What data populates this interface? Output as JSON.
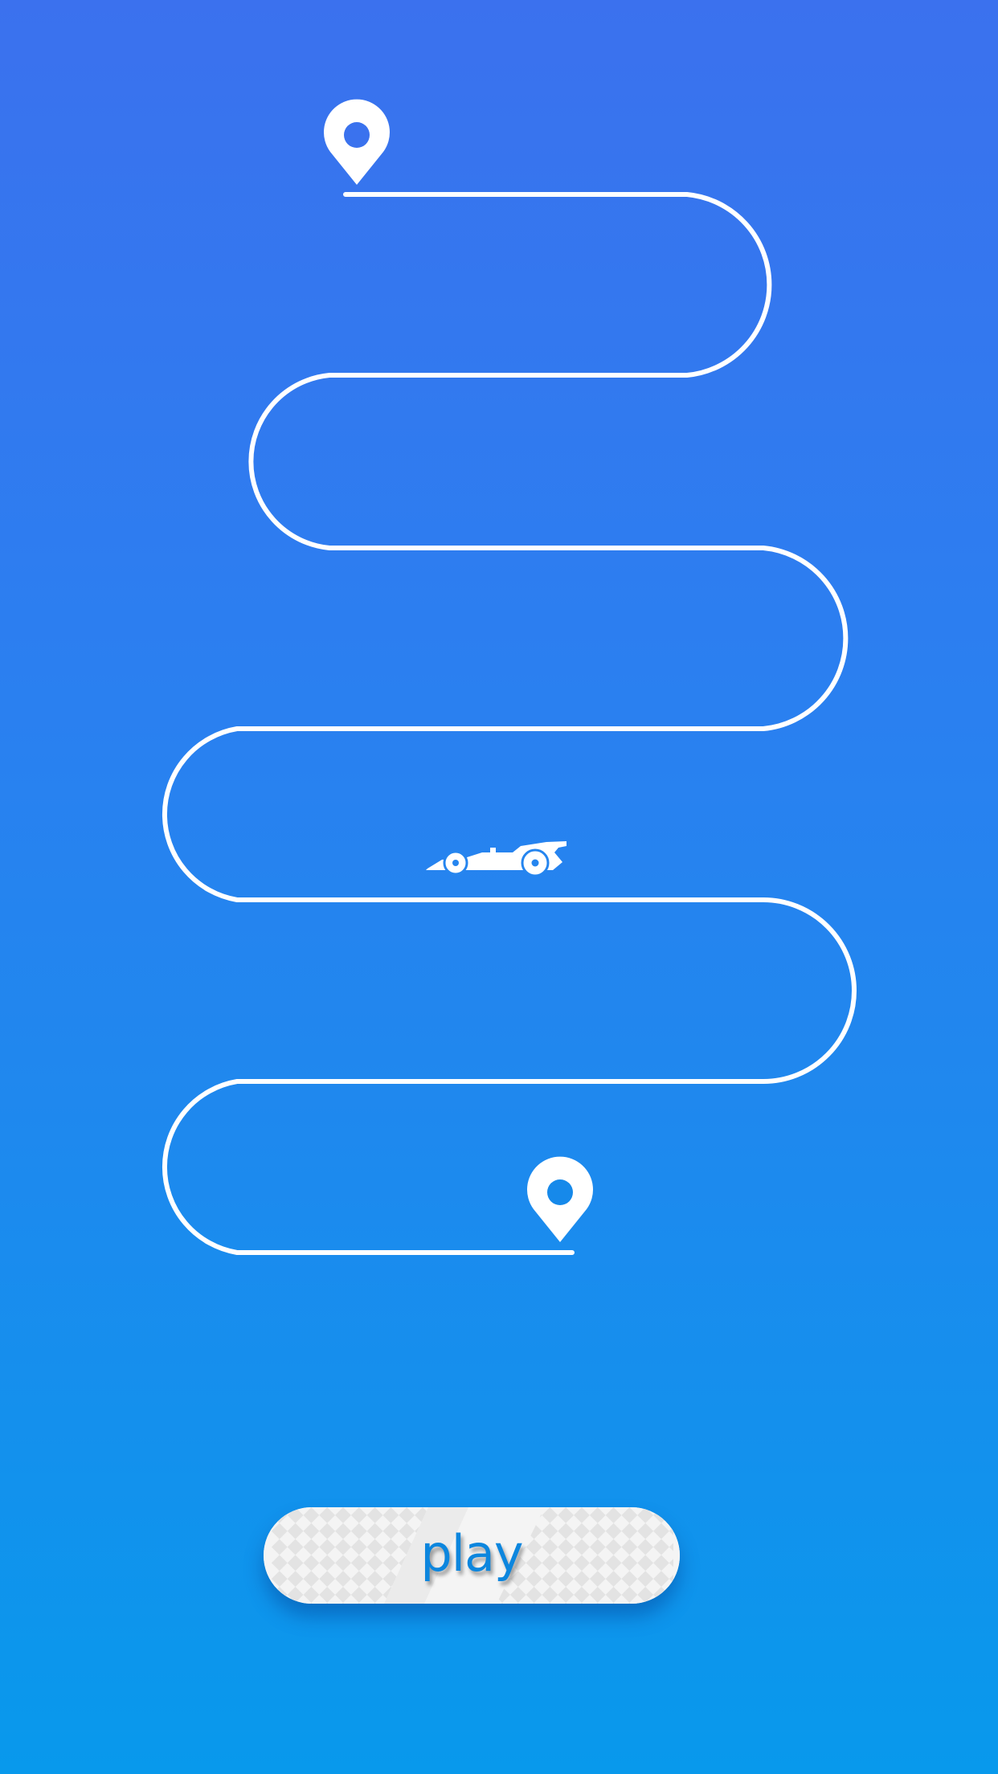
{
  "game": {
    "title": "",
    "play_button_label": "play"
  },
  "icons": {
    "start_marker": "map-pin-icon",
    "end_marker": "map-pin-icon",
    "vehicle": "race-car-icon"
  },
  "colors": {
    "background_top": "#3b71ee",
    "background_bottom": "#0899ec",
    "track": "#ffffff",
    "button_fill": "#f4f4f4",
    "button_checker": "#e2e2e2",
    "button_text": "#0c86de"
  }
}
